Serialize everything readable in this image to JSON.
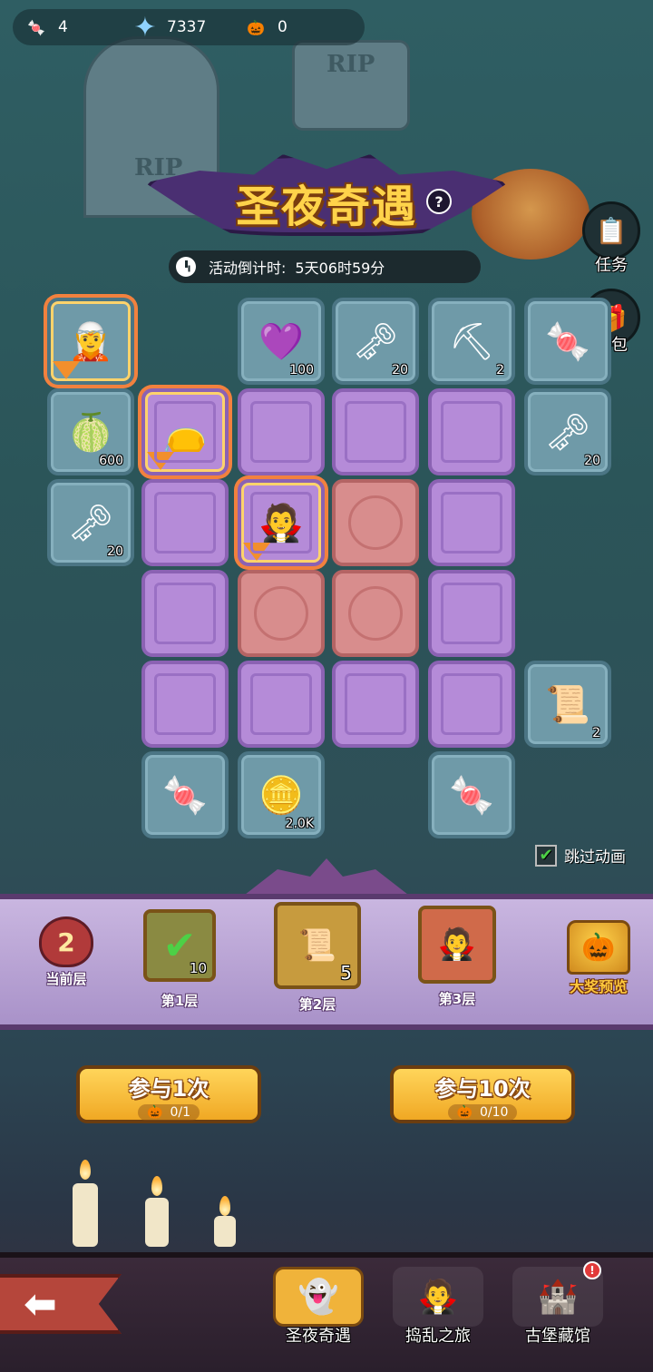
{
  "resources": [
    {
      "icon": "candy-icon",
      "glyph": "🍬",
      "value": "4"
    },
    {
      "icon": "star-gem-icon",
      "glyph": "✦",
      "value": "7337"
    },
    {
      "icon": "pumpkin-carriage-icon",
      "glyph": "🎃",
      "value": "0"
    }
  ],
  "title": "圣夜奇遇",
  "help_glyph": "?",
  "countdown": {
    "label": "活动倒计时:",
    "value": "5天06时59分"
  },
  "side_buttons": [
    {
      "name": "tasks",
      "glyph": "📋",
      "label": "任务"
    },
    {
      "name": "gift-pack",
      "glyph": "🎁",
      "label": "礼包"
    }
  ],
  "board": {
    "cells": [
      {
        "kind": "teal",
        "selected": true,
        "icon": "character-icon",
        "glyph": "🧝",
        "count": "",
        "marker": true
      },
      {
        "kind": "teal",
        "icon": "purple-gem-icon",
        "glyph": "💜",
        "count": "100"
      },
      {
        "kind": "teal",
        "icon": "windup-key-icon",
        "glyph": "🗝",
        "count": "20"
      },
      {
        "kind": "teal",
        "icon": "pickaxe-icon",
        "glyph": "⛏",
        "count": "2"
      },
      {
        "kind": "teal",
        "icon": "candy-icon",
        "glyph": "🍬",
        "count": ""
      },
      {
        "kind": "teal",
        "icon": "green-fruit-icon",
        "glyph": "🍈",
        "count": "600"
      },
      {
        "kind": "purple",
        "selected": true,
        "icon": "treasure-bag-icon",
        "glyph": "👝",
        "count": "",
        "marker": true
      },
      {
        "kind": "purple"
      },
      {
        "kind": "purple"
      },
      {
        "kind": "purple"
      },
      {
        "kind": "teal",
        "icon": "windup-key-icon",
        "glyph": "🗝",
        "count": "20"
      },
      {
        "kind": "teal",
        "icon": "windup-key-icon",
        "glyph": "🗝",
        "count": "20"
      },
      {
        "kind": "purple"
      },
      {
        "kind": "purple",
        "selected": true,
        "icon": "character-icon",
        "glyph": "🧛",
        "count": "",
        "marker": true
      },
      {
        "kind": "red"
      },
      {
        "kind": "purple"
      },
      {
        "kind": "purple"
      },
      {
        "kind": "red"
      },
      {
        "kind": "red"
      },
      {
        "kind": "purple"
      },
      {
        "kind": "purple"
      },
      {
        "kind": "purple"
      },
      {
        "kind": "purple"
      },
      {
        "kind": "purple"
      },
      {
        "kind": "teal",
        "icon": "scroll-icon",
        "glyph": "📜",
        "count": "2"
      },
      {
        "kind": "teal",
        "icon": "candy-icon",
        "glyph": "🍬",
        "count": ""
      },
      {
        "kind": "teal",
        "icon": "gold-coin-icon",
        "glyph": "🪙",
        "count": "2.0K"
      },
      {
        "kind": "teal",
        "icon": "candy-icon",
        "glyph": "🍬",
        "count": ""
      }
    ]
  },
  "skip_animation": {
    "label": "跳过动画",
    "checked": true
  },
  "floors": {
    "current": {
      "value": "2",
      "label": "当前层"
    },
    "items": [
      {
        "label": "第1层",
        "icon": "check-key-icon",
        "glyph": "✔",
        "count": "10"
      },
      {
        "label": "第2层",
        "icon": "scroll-icon",
        "glyph": "📜",
        "count": "5"
      },
      {
        "label": "第3层",
        "icon": "character-portrait-icon",
        "glyph": "🧛",
        "count": ""
      }
    ],
    "grand_prize": {
      "label": "大奖预览",
      "glyph": "🎃"
    }
  },
  "join_buttons": [
    {
      "label": "参与1次",
      "cost": "0/1"
    },
    {
      "label": "参与10次",
      "cost": "0/10"
    }
  ],
  "nav": {
    "back_glyph": "⬅",
    "tabs": [
      {
        "label": "圣夜奇遇",
        "glyph": "👻",
        "active": true
      },
      {
        "label": "捣乱之旅",
        "glyph": "🧛",
        "active": false
      },
      {
        "label": "古堡藏馆",
        "glyph": "🏰",
        "active": false,
        "alert": "!"
      }
    ]
  },
  "colors": {
    "accent_orange": "#f28f2c",
    "gold": "#ffd34a",
    "tile_purple": "#b58bd8",
    "tile_teal": "#6f9aa8",
    "tile_red": "#d88d8d"
  }
}
